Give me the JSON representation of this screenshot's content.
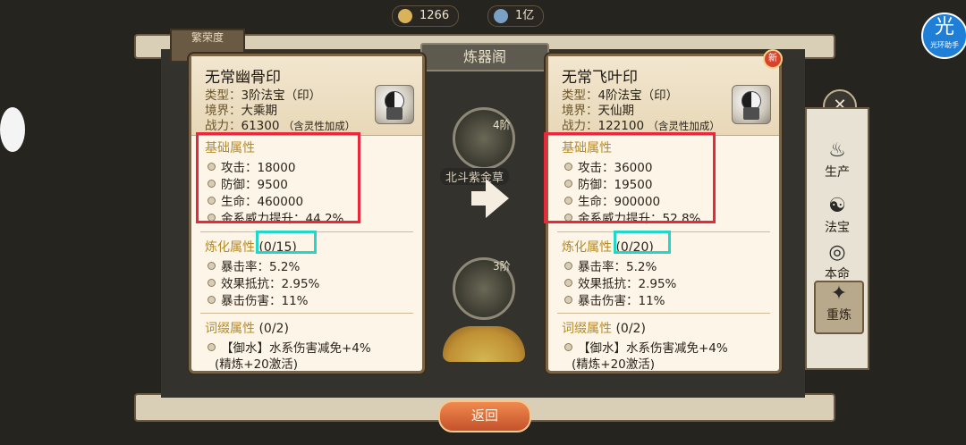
{
  "title": "炼器阁",
  "resources": [
    {
      "icon": "coin-icon",
      "value": "1266"
    },
    {
      "icon": "spirit-stone-icon",
      "value": "1亿"
    }
  ],
  "prosperity": {
    "label": "繁荣度"
  },
  "labels": {
    "type": "类型：",
    "realm": "境界：",
    "power": "战力：",
    "power_note": "（含灵性加成）",
    "basic": "基础属性",
    "refine": "炼化属性",
    "affix": "词缀属性"
  },
  "center": {
    "material_tier": "4阶",
    "material_name": "北斗紫金草",
    "result_tier": "3阶"
  },
  "left": {
    "name": "无常幽骨印",
    "type": "3阶法宝（印）",
    "realm": "大乘期",
    "power": "61300",
    "basic": [
      "攻击：18000",
      "防御：9500",
      "生命：460000",
      "金系威力提升：44.2%"
    ],
    "refine_count": "(0/15)",
    "refine": [
      "暴击率：5.2%",
      "效果抵抗：2.95%",
      "暴击伤害：11%"
    ],
    "affix_count": "(0/2)",
    "affix": [
      "【御水】水系伤害减免+4%"
    ],
    "affix_note": "(精炼+20激活)"
  },
  "right": {
    "badge": "新",
    "name": "无常飞叶印",
    "type": "4阶法宝（印）",
    "realm": "天仙期",
    "power": "122100",
    "basic": [
      "攻击：36000",
      "防御：19500",
      "生命：900000",
      "金系威力提升：52.8%"
    ],
    "refine_count": "(0/20)",
    "refine": [
      "暴击率：5.2%",
      "效果抵抗：2.95%",
      "暴击伤害：11%"
    ],
    "affix_count": "(0/2)",
    "affix": [
      "【御水】水系伤害减免+4%"
    ],
    "affix_note": "(精炼+20激活)"
  },
  "side_tabs": [
    "生产",
    "法宝",
    "本命",
    "重炼"
  ],
  "helper": {
    "glyph": "光",
    "label": "光环助手"
  },
  "back_label": "返回",
  "colors": {
    "highlight_red": "#e8283b",
    "highlight_cyan": "#22d7c8",
    "section_gold": "#b88a24"
  }
}
